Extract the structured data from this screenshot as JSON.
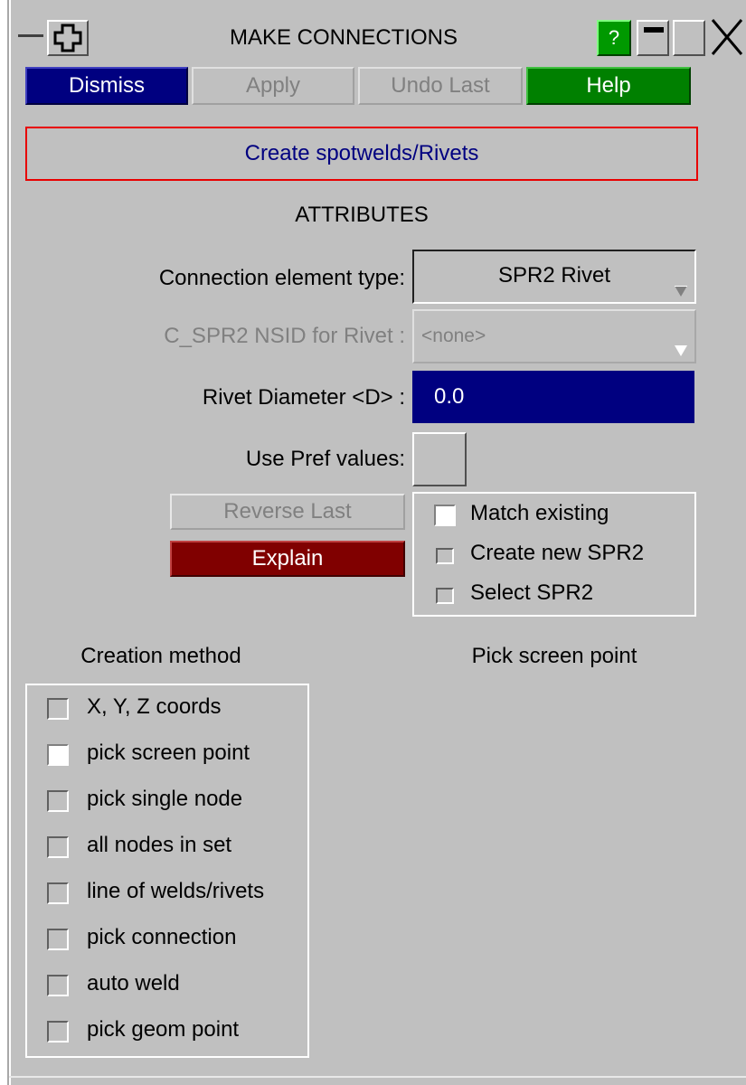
{
  "window": {
    "title": "MAKE CONNECTIONS",
    "help_glyph": "?",
    "icons": [
      "minus-icon",
      "move-cross-icon",
      "question-icon",
      "minimize-icon",
      "maximize-icon",
      "close-icon"
    ]
  },
  "toolbar": {
    "dismiss": "Dismiss",
    "apply": "Apply",
    "undo_last": "Undo Last",
    "help": "Help"
  },
  "mode": {
    "label": "Create spotwelds/Rivets"
  },
  "attributes": {
    "heading": "ATTRIBUTES",
    "connection_type_label": "Connection element type:",
    "connection_type_value": "SPR2 Rivet",
    "nsid_label": "C_SPR2 NSID for Rivet :",
    "nsid_value": "<none>",
    "diameter_label": "Rivet Diameter <D> :",
    "diameter_value": "0.0",
    "pref_label": "Use Pref values:"
  },
  "actions": {
    "reverse_last": "Reverse Last",
    "explain": "Explain"
  },
  "spr2_options": [
    {
      "label": "Match existing",
      "checked": true
    },
    {
      "label": "Create new SPR2",
      "checked": false
    },
    {
      "label": "Select SPR2",
      "checked": false
    }
  ],
  "sections": {
    "creation_method": "Creation method",
    "pick_screen_point": "Pick screen point"
  },
  "creation_methods": [
    {
      "label": "X, Y, Z coords",
      "checked": false
    },
    {
      "label": "pick screen point",
      "checked": true
    },
    {
      "label": "pick single node",
      "checked": false
    },
    {
      "label": "all nodes in set",
      "checked": false
    },
    {
      "label": "line of welds/rivets",
      "checked": false
    },
    {
      "label": "pick connection",
      "checked": false
    },
    {
      "label": "auto weld",
      "checked": false
    },
    {
      "label": "pick geom point",
      "checked": false
    }
  ],
  "colors": {
    "panel": "#c0c0c0",
    "dismiss": "#000080",
    "help": "#008000",
    "explain": "#800000",
    "mode_border": "#e80000",
    "mode_text": "#000080"
  }
}
